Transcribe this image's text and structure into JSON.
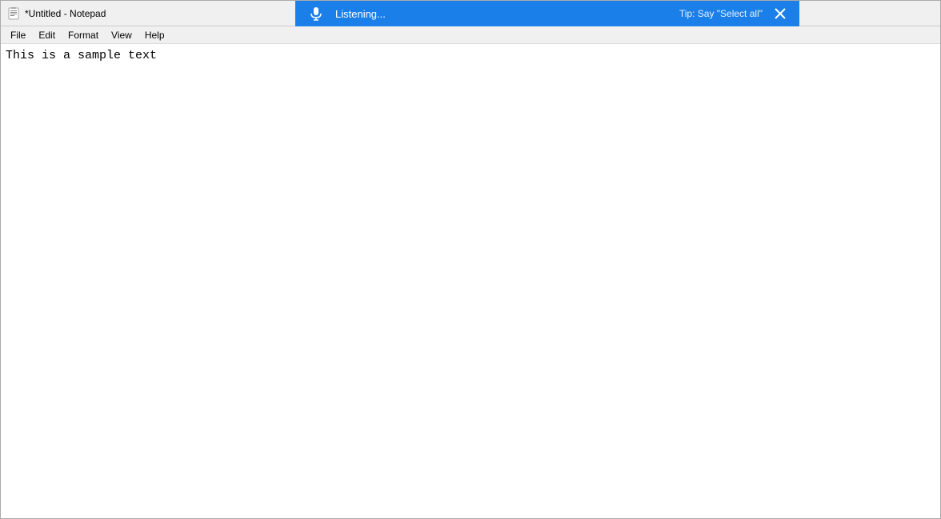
{
  "window": {
    "title": "*Untitled - Notepad"
  },
  "menu": {
    "items": [
      "File",
      "Edit",
      "Format",
      "View",
      "Help"
    ]
  },
  "voice_bar": {
    "listening_label": "Listening...",
    "tip_label": "Tip: Say \"Select all\""
  },
  "editor": {
    "content": "This is a sample text"
  }
}
